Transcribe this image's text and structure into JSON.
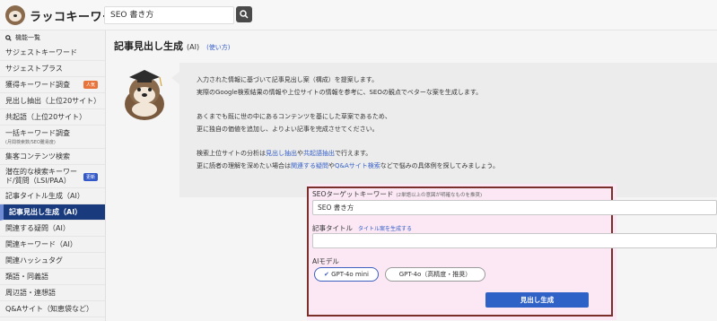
{
  "header": {
    "logo_text": "ラッコキーワード",
    "search_value": "SEO 書き方"
  },
  "sidebar": {
    "heading": "機能一覧",
    "items": [
      {
        "label": "サジェストキーワード"
      },
      {
        "label": "サジェストプラス"
      },
      {
        "label": "獲得キーワード調査",
        "badge": "人気"
      },
      {
        "label": "見出し抽出（上位20サイト）"
      },
      {
        "label": "共起語（上位20サイト）"
      },
      {
        "label": "一括キーワード調査",
        "sub": "(月間検索数/SEO難易度)"
      },
      {
        "label": "集客コンテンツ検索"
      },
      {
        "label": "潜在的な検索キーワード/質問（LSI/PAA）",
        "badge": "更新"
      },
      {
        "label": "記事タイトル生成（AI）"
      },
      {
        "label": "記事見出し生成（AI）"
      },
      {
        "label": "関連する疑問（AI）"
      },
      {
        "label": "関連キーワード（AI）"
      },
      {
        "label": "関連ハッシュタグ"
      },
      {
        "label": "類語・同義語"
      },
      {
        "label": "周辺語・連想語"
      },
      {
        "label": "Q&Aサイト（知恵袋など）"
      }
    ]
  },
  "main": {
    "title": "記事見出し生成",
    "title_sub": "(AI)",
    "help_link": "(使い方)",
    "info": {
      "line1": "入力された情報に基づいて記事見出し案（構成）を提案します。",
      "line2": "実際のGoogle検索結果の情報や上位サイトの情報を参考に、SEOの観点でベターな案を生成します。",
      "line3": "あくまでも既に世の中にあるコンテンツを基にした草案であるため、",
      "line4": "更に独自の価値を追加し、よりよい記事を完成させてください。",
      "line5_a": "検索上位サイトの分析は",
      "line5_link1": "見出し抽出",
      "line5_b": "や",
      "line5_link2": "共起語抽出",
      "line5_c": "で行えます。",
      "line6_a": "更に読者の理解を深めたい場合は",
      "line6_link1": "関連する疑問",
      "line6_b": "や",
      "line6_link2": "Q&Aサイト検索",
      "line6_c": "などで悩みの具体例を探してみましょう。"
    },
    "form": {
      "keyword_label": "SEOターゲットキーワード",
      "keyword_note": "(2単語以上の意図が明確なものを推奨)",
      "keyword_value": "SEO 書き方",
      "title_label": "記事タイトル",
      "title_link": "タイトル案を生成する",
      "title_value": "",
      "model_label": "AIモデル",
      "model_options": [
        {
          "label": "GPT-4o mini",
          "selected": true
        },
        {
          "label": "GPT-4o（高精度・推奨）",
          "selected": false
        }
      ],
      "submit_label": "見出し生成"
    }
  },
  "colors": {
    "accent": "#2f62c6",
    "sidebar_active": "#1a3a7e",
    "highlight_border": "#7a2f2a",
    "highlight_bg": "#fbe8f4"
  }
}
